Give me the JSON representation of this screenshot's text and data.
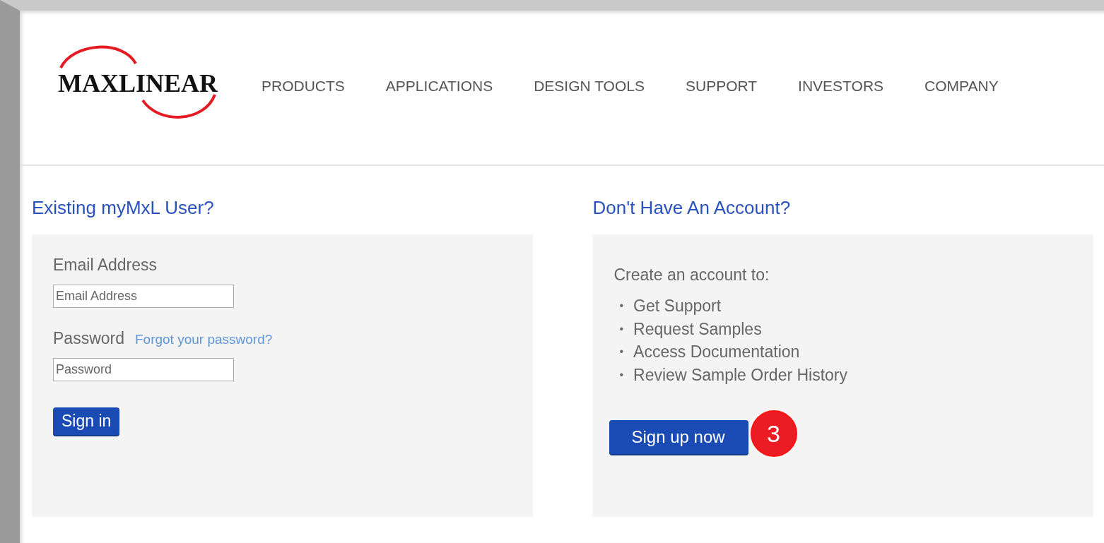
{
  "header": {
    "logo": {
      "text": "MAXLINEAR"
    },
    "nav": [
      "PRODUCTS",
      "APPLICATIONS",
      "DESIGN TOOLS",
      "SUPPORT",
      "INVESTORS",
      "COMPANY"
    ]
  },
  "sign_in": {
    "heading": "Existing myMxL User?",
    "email_label": "Email Address",
    "email_field": {
      "placeholder": "Email Address"
    },
    "password_label": "Password",
    "forgot_link": "Forgot your password?",
    "password_field": {
      "placeholder": "Password"
    },
    "button": "Sign in"
  },
  "sign_up": {
    "heading": "Don't Have An Account?",
    "intro": "Create an account to:",
    "benefits": [
      {
        "bullet": "•",
        "text": "Get Support"
      },
      {
        "bullet": "•",
        "text": "Request Samples"
      },
      {
        "bullet": "•",
        "text": "Access Documentation"
      },
      {
        "bullet": "•",
        "text": "Review Sample Order History"
      }
    ],
    "button": "Sign up now",
    "step_badge": "3"
  }
}
